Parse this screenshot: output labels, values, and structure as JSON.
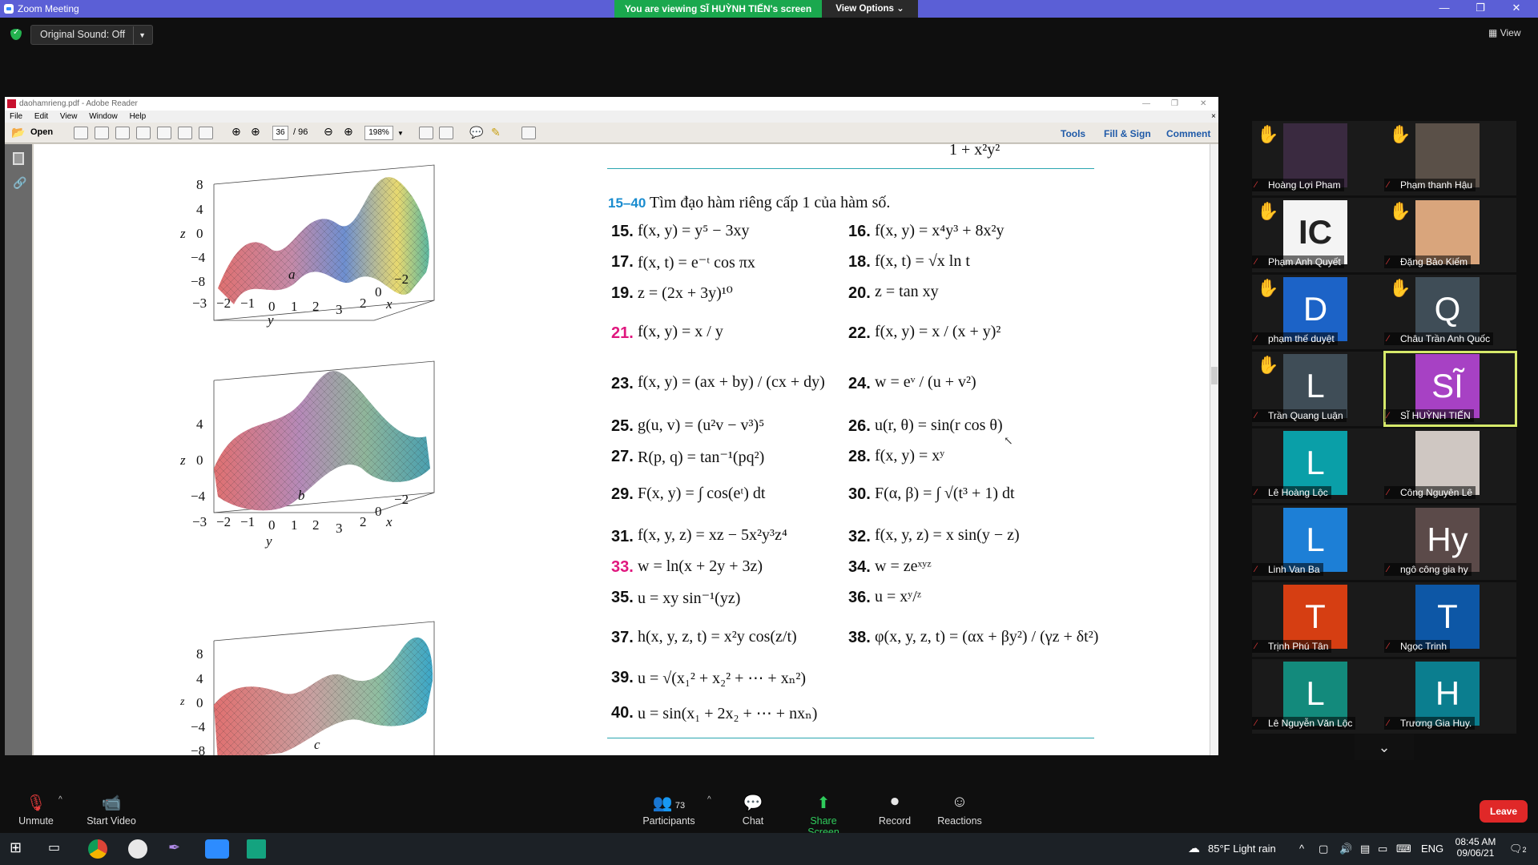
{
  "zoom": {
    "window_title": "Zoom Meeting",
    "share_banner": "You are viewing SĨ HUỲNH TIẾN's screen",
    "view_options": "View Options",
    "original_sound": "Original Sound: Off",
    "view_label": "View",
    "window_controls": {
      "minimize": "—",
      "restore": "❐",
      "close": "✕"
    }
  },
  "reader": {
    "title": "daohamrieng.pdf - Adobe Reader",
    "menu": [
      "File",
      "Edit",
      "View",
      "Window",
      "Help"
    ],
    "open_label": "Open",
    "page_current": "36",
    "page_total": "/ 96",
    "zoom_level": "198%",
    "tools": "Tools",
    "fill_sign": "Fill & Sign",
    "comment": "Comment"
  },
  "document": {
    "top_partial": "1 + x²y²",
    "heading_range": "15–40",
    "heading_text": "Tìm đạo hàm riêng cấp 1 của hàm số.",
    "exercises": [
      {
        "n": "15.",
        "eq": "f(x, y) = y⁵ − 3xy",
        "highlight": false
      },
      {
        "n": "16.",
        "eq": "f(x, y) = x⁴y³ + 8x²y",
        "highlight": false
      },
      {
        "n": "17.",
        "eq": "f(x, t) = e⁻ᵗ cos πx",
        "highlight": false
      },
      {
        "n": "18.",
        "eq": "f(x, t) = √x ln t",
        "highlight": false
      },
      {
        "n": "19.",
        "eq": "z = (2x + 3y)¹⁰",
        "highlight": false
      },
      {
        "n": "20.",
        "eq": "z = tan xy",
        "highlight": false
      },
      {
        "n": "21.",
        "eq": "f(x, y) = x / y",
        "highlight": true
      },
      {
        "n": "22.",
        "eq": "f(x, y) = x / (x + y)²",
        "highlight": false
      },
      {
        "n": "23.",
        "eq": "f(x, y) = (ax + by) / (cx + dy)",
        "highlight": false
      },
      {
        "n": "24.",
        "eq": "w = eᵛ / (u + v²)",
        "highlight": false
      },
      {
        "n": "25.",
        "eq": "g(u, v) = (u²v − v³)⁵",
        "highlight": false
      },
      {
        "n": "26.",
        "eq": "u(r, θ) = sin(r cos θ)",
        "highlight": false
      },
      {
        "n": "27.",
        "eq": "R(p, q) = tan⁻¹(pq²)",
        "highlight": false
      },
      {
        "n": "28.",
        "eq": "f(x, y) = xʸ",
        "highlight": false
      },
      {
        "n": "29.",
        "eq": "F(x, y) = ∫ cos(eᵗ) dt",
        "highlight": false
      },
      {
        "n": "30.",
        "eq": "F(α, β) = ∫ √(t³ + 1) dt",
        "highlight": false
      },
      {
        "n": "31.",
        "eq": "f(x, y, z) = xz − 5x²y³z⁴",
        "highlight": false
      },
      {
        "n": "32.",
        "eq": "f(x, y, z) = x sin(y − z)",
        "highlight": false
      },
      {
        "n": "33.",
        "eq": "w = ln(x + 2y + 3z)",
        "highlight": true
      },
      {
        "n": "34.",
        "eq": "w = zeˣʸᶻ",
        "highlight": false
      },
      {
        "n": "35.",
        "eq": "u = xy sin⁻¹(yz)",
        "highlight": false
      },
      {
        "n": "36.",
        "eq": "u = xʸ/ᶻ",
        "highlight": false
      },
      {
        "n": "37.",
        "eq": "h(x, y, z, t) = x²y cos(z/t)",
        "highlight": false
      },
      {
        "n": "38.",
        "eq": "φ(x, y, z, t) = (αx + βy²) / (γz + δt²)",
        "highlight": false
      },
      {
        "n": "39.",
        "eq": "u = √(x₁² + x₂² + ⋯ + xₙ²)",
        "highlight": false
      },
      {
        "n": "40.",
        "eq": "u = sin(x₁ + 2x₂ + ⋯ + nxₙ)",
        "highlight": false
      }
    ],
    "plots": [
      {
        "label": "a",
        "z_ticks": [
          "8",
          "4",
          "0",
          "−4",
          "−8"
        ],
        "y_ticks": [
          "−3",
          "−2",
          "−1",
          "0",
          "1",
          "2",
          "3"
        ],
        "x_ticks": [
          "2",
          "0",
          "−2"
        ],
        "z_axis": "z",
        "y_axis": "y",
        "x_axis": "x"
      },
      {
        "label": "b",
        "z_ticks": [
          "4",
          "0",
          "−4"
        ],
        "y_ticks": [
          "−3",
          "−2",
          "−1",
          "0",
          "1",
          "2",
          "3"
        ],
        "x_ticks": [
          "2",
          "0",
          "−2"
        ],
        "z_axis": "z",
        "y_axis": "y",
        "x_axis": "x"
      },
      {
        "label": "c",
        "z_ticks": [
          "8",
          "4",
          "0",
          "−4",
          "−8"
        ],
        "z_axis": "z"
      }
    ]
  },
  "participants": [
    {
      "name": "Hoàng Lợi Pham",
      "hand": true,
      "initial": "",
      "color": "#3a2a40"
    },
    {
      "name": "Phạm thanh Hậu",
      "hand": true,
      "initial": "",
      "color": "#5a5048"
    },
    {
      "name": "Phạm Anh Quyết",
      "hand": true,
      "initial": "IC",
      "color": "#f4f4f4"
    },
    {
      "name": "Đặng Bảo Kiếm",
      "hand": true,
      "initial": "",
      "color": "#d9a57c"
    },
    {
      "name": "phạm thế duyệt",
      "hand": true,
      "initial": "D",
      "color": "#1c63c7"
    },
    {
      "name": "Châu Trần Anh Quốc",
      "hand": true,
      "initial": "Q",
      "color": "#3f4d57"
    },
    {
      "name": "Trần Quang Luận",
      "hand": true,
      "initial": "L",
      "color": "#3f4d57"
    },
    {
      "name": "SĨ HUỲNH TIẾN",
      "hand": false,
      "initial": "SĨ",
      "color": "#a741c4"
    },
    {
      "name": "Lê Hoàng Lộc",
      "hand": false,
      "initial": "L",
      "color": "#0a9fa8"
    },
    {
      "name": "Công Nguyên Lê",
      "hand": false,
      "initial": "",
      "color": "#cfc7c2"
    },
    {
      "name": "Linh Van Ba",
      "hand": false,
      "initial": "L",
      "color": "#1d7fd6"
    },
    {
      "name": "ngô công gia hy",
      "hand": false,
      "initial": "Hy",
      "color": "#5b4a49"
    },
    {
      "name": "Trịnh Phú Tân",
      "hand": false,
      "initial": "T",
      "color": "#d63e12"
    },
    {
      "name": "Ngọc Trinh",
      "hand": false,
      "initial": "T",
      "color": "#0d57a6"
    },
    {
      "name": "Lê Nguyễn Văn Lộc",
      "hand": false,
      "initial": "L",
      "color": "#138a7c"
    },
    {
      "name": "Trương Gia Huy.",
      "hand": false,
      "initial": "H",
      "color": "#0b7e8f"
    }
  ],
  "controls": {
    "unmute": "Unmute",
    "start_video": "Start Video",
    "participants": "Participants",
    "participants_count": "73",
    "chat": "Chat",
    "share_screen": "Share Screen",
    "record": "Record",
    "reactions": "Reactions",
    "leave": "Leave"
  },
  "taskbar": {
    "weather": "85°F  Light rain",
    "lang": "ENG",
    "time": "08:45 AM",
    "date": "09/06/21",
    "notif": "2"
  }
}
